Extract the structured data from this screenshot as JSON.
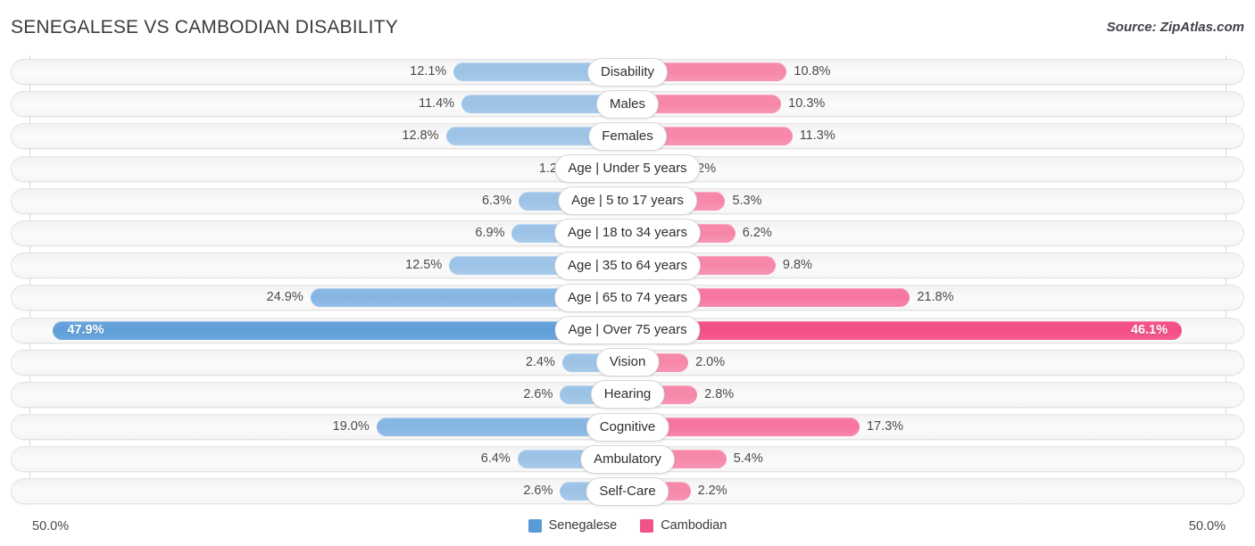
{
  "header": {
    "title": "SENEGALESE VS CAMBODIAN DISABILITY",
    "source": "Source: ZipAtlas.com"
  },
  "axis": {
    "left_label": "50.0%",
    "right_label": "50.0%"
  },
  "legend": [
    {
      "label": "Senegalese",
      "color": "#5b9bd5"
    },
    {
      "label": "Cambodian",
      "color": "#f2528a"
    }
  ],
  "chart_data": {
    "type": "bar",
    "title": "SENEGALESE VS CAMBODIAN DISABILITY",
    "subtitle": "Source: ZipAtlas.com",
    "orientation": "horizontal-diverging",
    "xlabel": "",
    "ylabel": "",
    "xlim": [
      -50.0,
      50.0
    ],
    "axis_left_max": "50.0%",
    "axis_right_max": "50.0%",
    "grid": false,
    "legend_position": "bottom-center",
    "categories": [
      "Disability",
      "Males",
      "Females",
      "Age | Under 5 years",
      "Age | 5 to 17 years",
      "Age | 18 to 34 years",
      "Age | 35 to 64 years",
      "Age | 65 to 74 years",
      "Age | Over 75 years",
      "Vision",
      "Hearing",
      "Cognitive",
      "Ambulatory",
      "Self-Care"
    ],
    "series": [
      {
        "name": "Senegalese",
        "color": "#5b9bd5",
        "values": [
          12.1,
          11.4,
          12.8,
          1.2,
          6.3,
          6.9,
          12.5,
          24.9,
          47.9,
          2.4,
          2.6,
          19.0,
          6.4,
          2.6
        ],
        "labels": [
          "12.1%",
          "11.4%",
          "12.8%",
          "1.2%",
          "6.3%",
          "6.9%",
          "12.5%",
          "24.9%",
          "47.9%",
          "2.4%",
          "2.6%",
          "19.0%",
          "6.4%",
          "2.6%"
        ]
      },
      {
        "name": "Cambodian",
        "color": "#f2528a",
        "values": [
          10.8,
          10.3,
          11.3,
          1.2,
          5.3,
          6.2,
          9.8,
          21.8,
          46.1,
          2.0,
          2.8,
          17.3,
          5.4,
          2.2
        ],
        "labels": [
          "10.8%",
          "10.3%",
          "11.3%",
          "1.2%",
          "5.3%",
          "6.2%",
          "9.8%",
          "21.8%",
          "46.1%",
          "2.0%",
          "2.8%",
          "17.3%",
          "5.4%",
          "2.2%"
        ]
      }
    ]
  },
  "rows": [
    {
      "label": "Disability",
      "left_value": 12.1,
      "left_label": "12.1%",
      "right_value": 10.8,
      "right_label": "10.8%",
      "emphasis": "normal"
    },
    {
      "label": "Males",
      "left_value": 11.4,
      "left_label": "11.4%",
      "right_value": 10.3,
      "right_label": "10.3%",
      "emphasis": "normal"
    },
    {
      "label": "Females",
      "left_value": 12.8,
      "left_label": "12.8%",
      "right_value": 11.3,
      "right_label": "11.3%",
      "emphasis": "normal"
    },
    {
      "label": "Age | Under 5 years",
      "left_value": 1.2,
      "left_label": "1.2%",
      "right_value": 1.2,
      "right_label": "1.2%",
      "emphasis": "normal"
    },
    {
      "label": "Age | 5 to 17 years",
      "left_value": 6.3,
      "left_label": "6.3%",
      "right_value": 5.3,
      "right_label": "5.3%",
      "emphasis": "normal"
    },
    {
      "label": "Age | 18 to 34 years",
      "left_value": 6.9,
      "left_label": "6.9%",
      "right_value": 6.2,
      "right_label": "6.2%",
      "emphasis": "normal"
    },
    {
      "label": "Age | 35 to 64 years",
      "left_value": 12.5,
      "left_label": "12.5%",
      "right_value": 9.8,
      "right_label": "9.8%",
      "emphasis": "normal"
    },
    {
      "label": "Age | 65 to 74 years",
      "left_value": 24.9,
      "left_label": "24.9%",
      "right_value": 21.8,
      "right_label": "21.8%",
      "emphasis": "mid"
    },
    {
      "label": "Age | Over 75 years",
      "left_value": 47.9,
      "left_label": "47.9%",
      "right_value": 46.1,
      "right_label": "46.1%",
      "emphasis": "highlight"
    },
    {
      "label": "Vision",
      "left_value": 2.4,
      "left_label": "2.4%",
      "right_value": 2.0,
      "right_label": "2.0%",
      "emphasis": "normal"
    },
    {
      "label": "Hearing",
      "left_value": 2.6,
      "left_label": "2.6%",
      "right_value": 2.8,
      "right_label": "2.8%",
      "emphasis": "normal"
    },
    {
      "label": "Cognitive",
      "left_value": 19.0,
      "left_label": "19.0%",
      "right_value": 17.3,
      "right_label": "17.3%",
      "emphasis": "mid"
    },
    {
      "label": "Ambulatory",
      "left_value": 6.4,
      "left_label": "6.4%",
      "right_value": 5.4,
      "right_label": "5.4%",
      "emphasis": "normal"
    },
    {
      "label": "Self-Care",
      "left_value": 2.6,
      "left_label": "2.6%",
      "right_value": 2.2,
      "right_label": "2.2%",
      "emphasis": "normal"
    }
  ]
}
